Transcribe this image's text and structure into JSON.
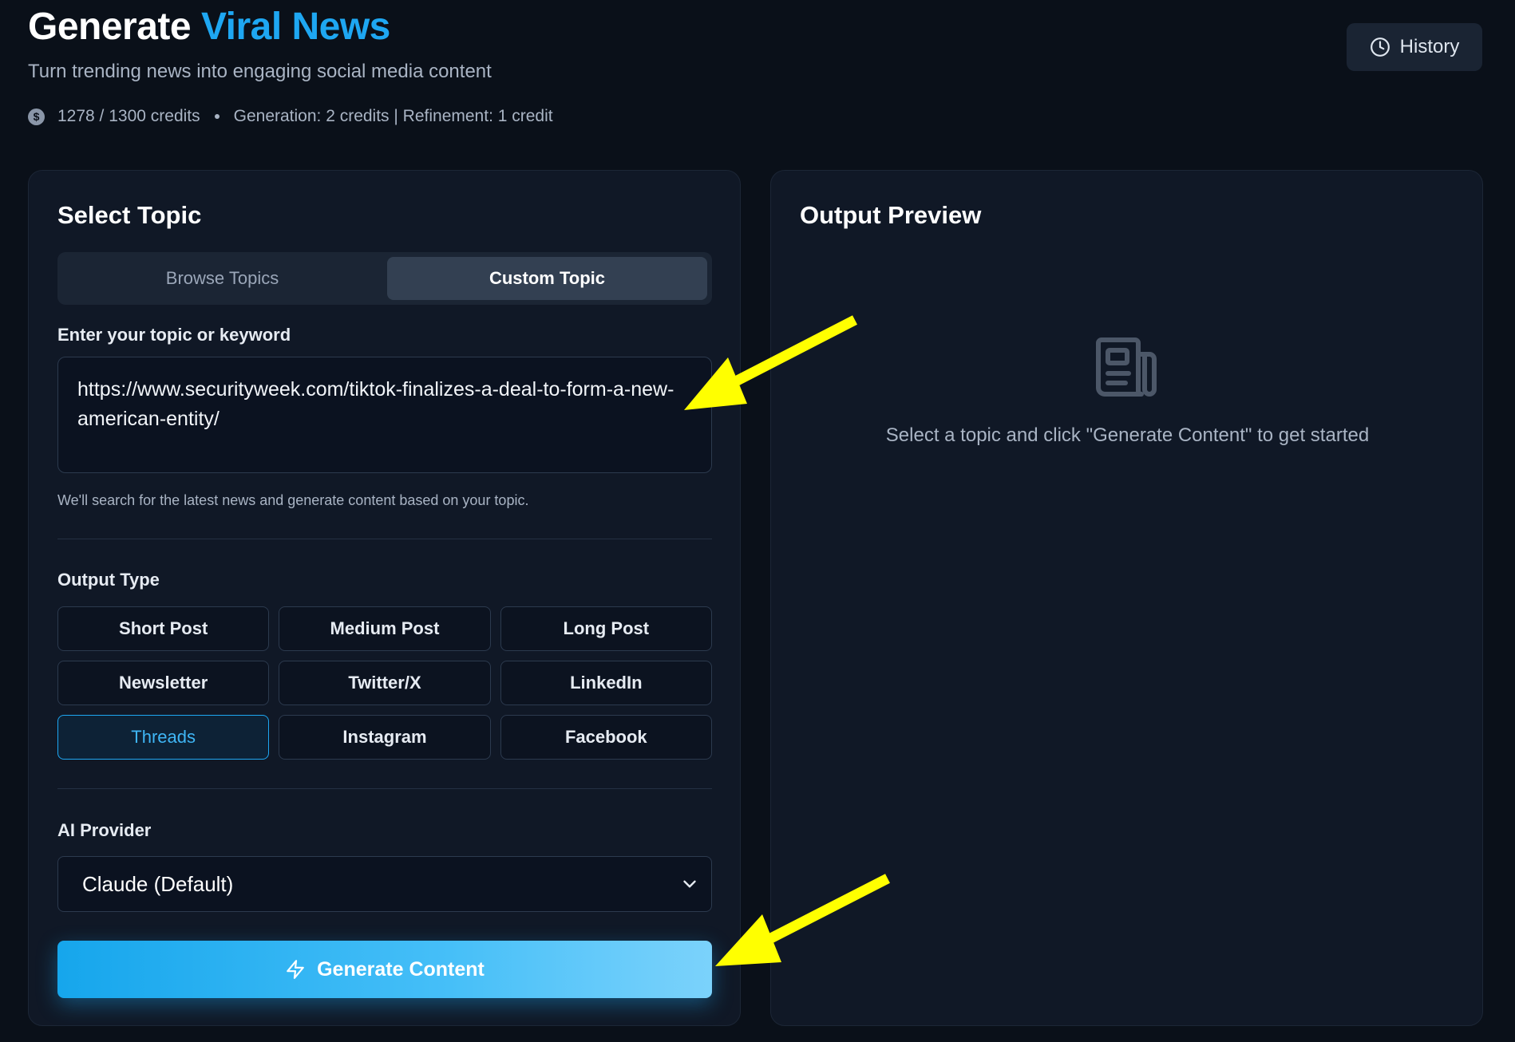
{
  "header": {
    "title_main": "Generate",
    "title_accent": "Viral News",
    "subtitle": "Turn trending news into engaging social media content",
    "credits": "1278 / 1300 credits",
    "pricing": "Generation: 2 credits | Refinement: 1 credit",
    "history_label": "History"
  },
  "left_panel": {
    "title": "Select Topic",
    "tabs": [
      {
        "label": "Browse Topics",
        "active": false
      },
      {
        "label": "Custom Topic",
        "active": true
      }
    ],
    "topic_label": "Enter your topic or keyword",
    "topic_value": "https://www.securityweek.com/tiktok-finalizes-a-deal-to-form-a-new-american-entity/",
    "topic_helper": "We'll search for the latest news and generate content based on your topic.",
    "output_type_label": "Output Type",
    "output_types": [
      "Short Post",
      "Medium Post",
      "Long Post",
      "Newsletter",
      "Twitter/X",
      "LinkedIn",
      "Threads",
      "Instagram",
      "Facebook"
    ],
    "selected_output_type": "Threads",
    "ai_provider_label": "AI Provider",
    "ai_provider_value": "Claude (Default)",
    "generate_label": "Generate Content"
  },
  "right_panel": {
    "title": "Output Preview",
    "empty_message": "Select a topic and click \"Generate Content\" to get started",
    "empty_icon": "newspaper-icon"
  },
  "colors": {
    "accent": "#1ea7f2",
    "background": "#0a1019",
    "panel": "#101826",
    "annotation_arrow": "#ffff00"
  },
  "annotations": [
    "arrow pointing to topic input",
    "arrow pointing to generate button"
  ]
}
